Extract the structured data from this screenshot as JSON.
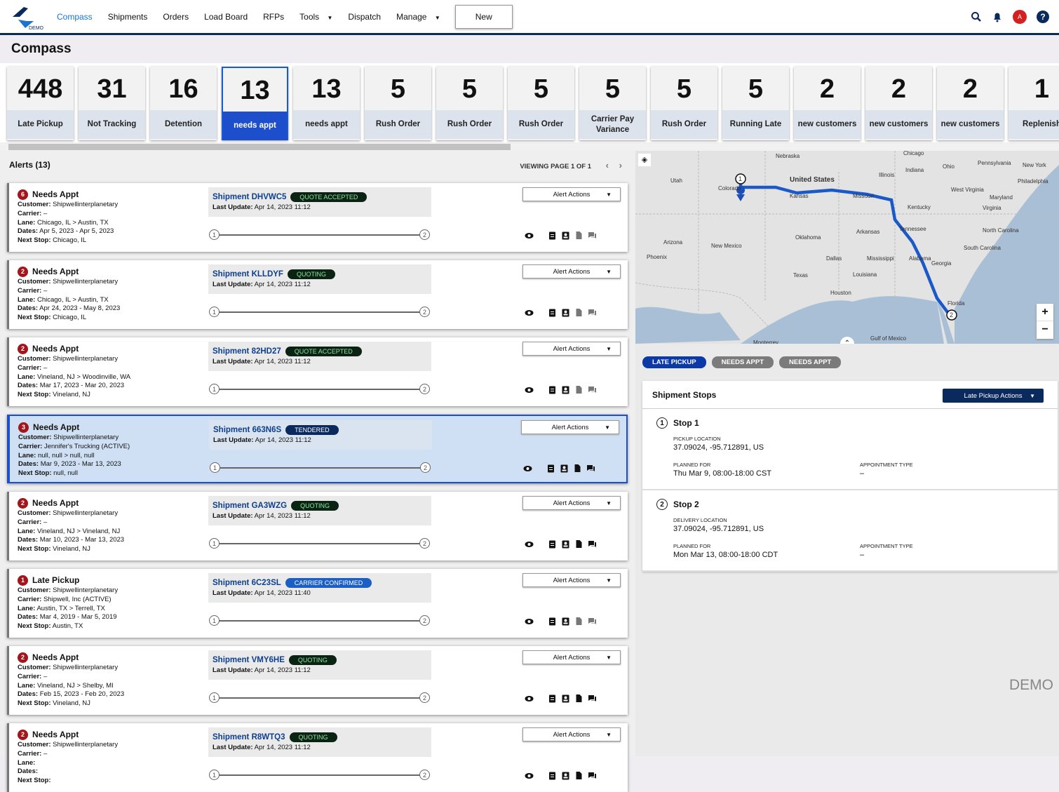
{
  "header": {
    "logo_text": "DEMO",
    "nav": [
      "Compass",
      "Shipments",
      "Orders",
      "Load Board",
      "RFPs",
      "Tools",
      "Dispatch",
      "Manage"
    ],
    "new_label": "New",
    "avatar": "A"
  },
  "page_title": "Compass",
  "kpis": [
    {
      "n": "448",
      "l": "Late Pickup"
    },
    {
      "n": "31",
      "l": "Not Tracking"
    },
    {
      "n": "16",
      "l": "Detention"
    },
    {
      "n": "13",
      "l": "needs appt"
    },
    {
      "n": "13",
      "l": "needs appt"
    },
    {
      "n": "5",
      "l": "Rush Order"
    },
    {
      "n": "5",
      "l": "Rush Order"
    },
    {
      "n": "5",
      "l": "Rush Order"
    },
    {
      "n": "5",
      "l": "Carrier Pay Variance"
    },
    {
      "n": "5",
      "l": "Rush Order"
    },
    {
      "n": "5",
      "l": "Running Late"
    },
    {
      "n": "2",
      "l": "new customers"
    },
    {
      "n": "2",
      "l": "new customers"
    },
    {
      "n": "2",
      "l": "new customers"
    },
    {
      "n": "1",
      "l": "Replenish"
    }
  ],
  "alerts": {
    "title": "Alerts (13)",
    "pager": "VIEWING PAGE 1 OF 1",
    "actions_label": "Alert Actions",
    "labels": {
      "customer": "Customer:",
      "carrier": "Carrier:",
      "lane": "Lane:",
      "dates": "Dates:",
      "next": "Next Stop:",
      "last": "Last Update:"
    },
    "items": [
      {
        "count": "6",
        "type": "Needs Appt",
        "customer": "Shipwellinterplanetary",
        "carrier": "–",
        "lane": "Chicago, IL > Austin, TX",
        "dates": "Apr 5, 2023 - Apr 5, 2023",
        "next": "Chicago, IL",
        "shipment": "Shipment DHVWC5",
        "status": "QUOTE ACCEPTED",
        "updated": "Apr 14, 2023 11:12"
      },
      {
        "count": "2",
        "type": "Needs Appt",
        "customer": "Shipwellinterplanetary",
        "carrier": "–",
        "lane": "Chicago, IL > Austin, TX",
        "dates": "Apr 24, 2023 - May 8, 2023",
        "next": "Chicago, IL",
        "shipment": "Shipment KLLDYF",
        "status": "QUOTING",
        "updated": "Apr 14, 2023 11:12"
      },
      {
        "count": "2",
        "type": "Needs Appt",
        "customer": "Shipwellinterplanetary",
        "carrier": "–",
        "lane": "Vineland, NJ > Woodinville, WA",
        "dates": "Mar 17, 2023 - Mar 20, 2023",
        "next": "Vineland, NJ",
        "shipment": "Shipment 82HD27",
        "status": "QUOTE ACCEPTED",
        "updated": "Apr 14, 2023 11:12"
      },
      {
        "count": "3",
        "type": "Needs Appt",
        "customer": "Shipwellinterplanetary",
        "carrier": "Jennifer's Trucking (ACTIVE)",
        "lane": "null, null > null, null",
        "dates": "Mar 9, 2023 - Mar 13, 2023",
        "next": "null, null",
        "shipment": "Shipment 663N6S",
        "status": "TENDERED",
        "updated": "Apr 14, 2023 11:12"
      },
      {
        "count": "2",
        "type": "Needs Appt",
        "customer": "Shipwellinterplanetary",
        "carrier": "–",
        "lane": "Vineland, NJ > Vineland, NJ",
        "dates": "Mar 10, 2023 - Mar 13, 2023",
        "next": "Vineland, NJ",
        "shipment": "Shipment GA3WZG",
        "status": "QUOTING",
        "updated": "Apr 14, 2023 11:12"
      },
      {
        "count": "1",
        "type": "Late Pickup",
        "customer": "Shipwellinterplanetary",
        "carrier": "Shipwell, Inc (ACTIVE)",
        "lane": "Austin, TX > Terrell, TX",
        "dates": "Mar 4, 2019 - Mar 5, 2019",
        "next": "Austin, TX",
        "shipment": "Shipment 6C23SL",
        "status": "CARRIER CONFIRMED",
        "updated": "Apr 14, 2023 11:40"
      },
      {
        "count": "2",
        "type": "Needs Appt",
        "customer": "Shipwellinterplanetary",
        "carrier": "–",
        "lane": "Vineland, NJ > Shelby, MI",
        "dates": "Feb 15, 2023 - Feb 20, 2023",
        "next": "Vineland, NJ",
        "shipment": "Shipment VMY6HE",
        "status": "QUOTING",
        "updated": "Apr 14, 2023 11:12"
      },
      {
        "count": "2",
        "type": "Needs Appt",
        "customer": "Shipwellinterplanetary",
        "carrier": "–",
        "lane": "",
        "dates": "",
        "next": "",
        "shipment": "Shipment R8WTQ3",
        "status": "QUOTING",
        "updated": "Apr 14, 2023 11:12"
      }
    ]
  },
  "status_colors": {
    "QUOTE ACCEPTED": "#0a2312",
    "QUOTING": "#0a2312",
    "TENDERED": "#0a2a5e",
    "CARRIER CONFIRMED": "#1c5fc4"
  },
  "map": {
    "labels": [
      "Nebraska",
      "United States",
      "Utah",
      "Colorado",
      "Kansas",
      "Missouri",
      "Illinois",
      "Indiana",
      "Ohio",
      "Pennsylvania",
      "New York",
      "Philadelphia",
      "West Virginia",
      "Maryland",
      "Kentucky",
      "Virginia",
      "Tennessee",
      "North Carolina",
      "Arkansas",
      "Oklahoma",
      "Arizona",
      "New Mexico",
      "Phoenix",
      "Dallas",
      "Mississippi",
      "Alabama",
      "Georgia",
      "South Carolina",
      "Texas",
      "Louisiana",
      "Houston",
      "Florida",
      "Monterrey",
      "Gulf of Mexico",
      "Chicago"
    ]
  },
  "tabs": [
    "LATE PICKUP",
    "NEEDS APPT",
    "NEEDS APPT"
  ],
  "stops": {
    "title": "Shipment Stops",
    "actions": "Late Pickup Actions",
    "appt_label": "APPOINTMENT TYPE",
    "planned_label": "PLANNED FOR",
    "items": [
      {
        "n": "1",
        "name": "Stop 1",
        "loc_label": "PICKUP LOCATION",
        "loc": "37.09024, -95.712891, US",
        "planned": "Thu Mar 9, 08:00-18:00 CST",
        "appt": "–"
      },
      {
        "n": "2",
        "name": "Stop 2",
        "loc_label": "DELIVERY LOCATION",
        "loc": "37.09024, -95.712891, US",
        "planned": "Mon Mar 13, 08:00-18:00 CDT",
        "appt": "–"
      }
    ]
  },
  "watermark": "DEMO"
}
